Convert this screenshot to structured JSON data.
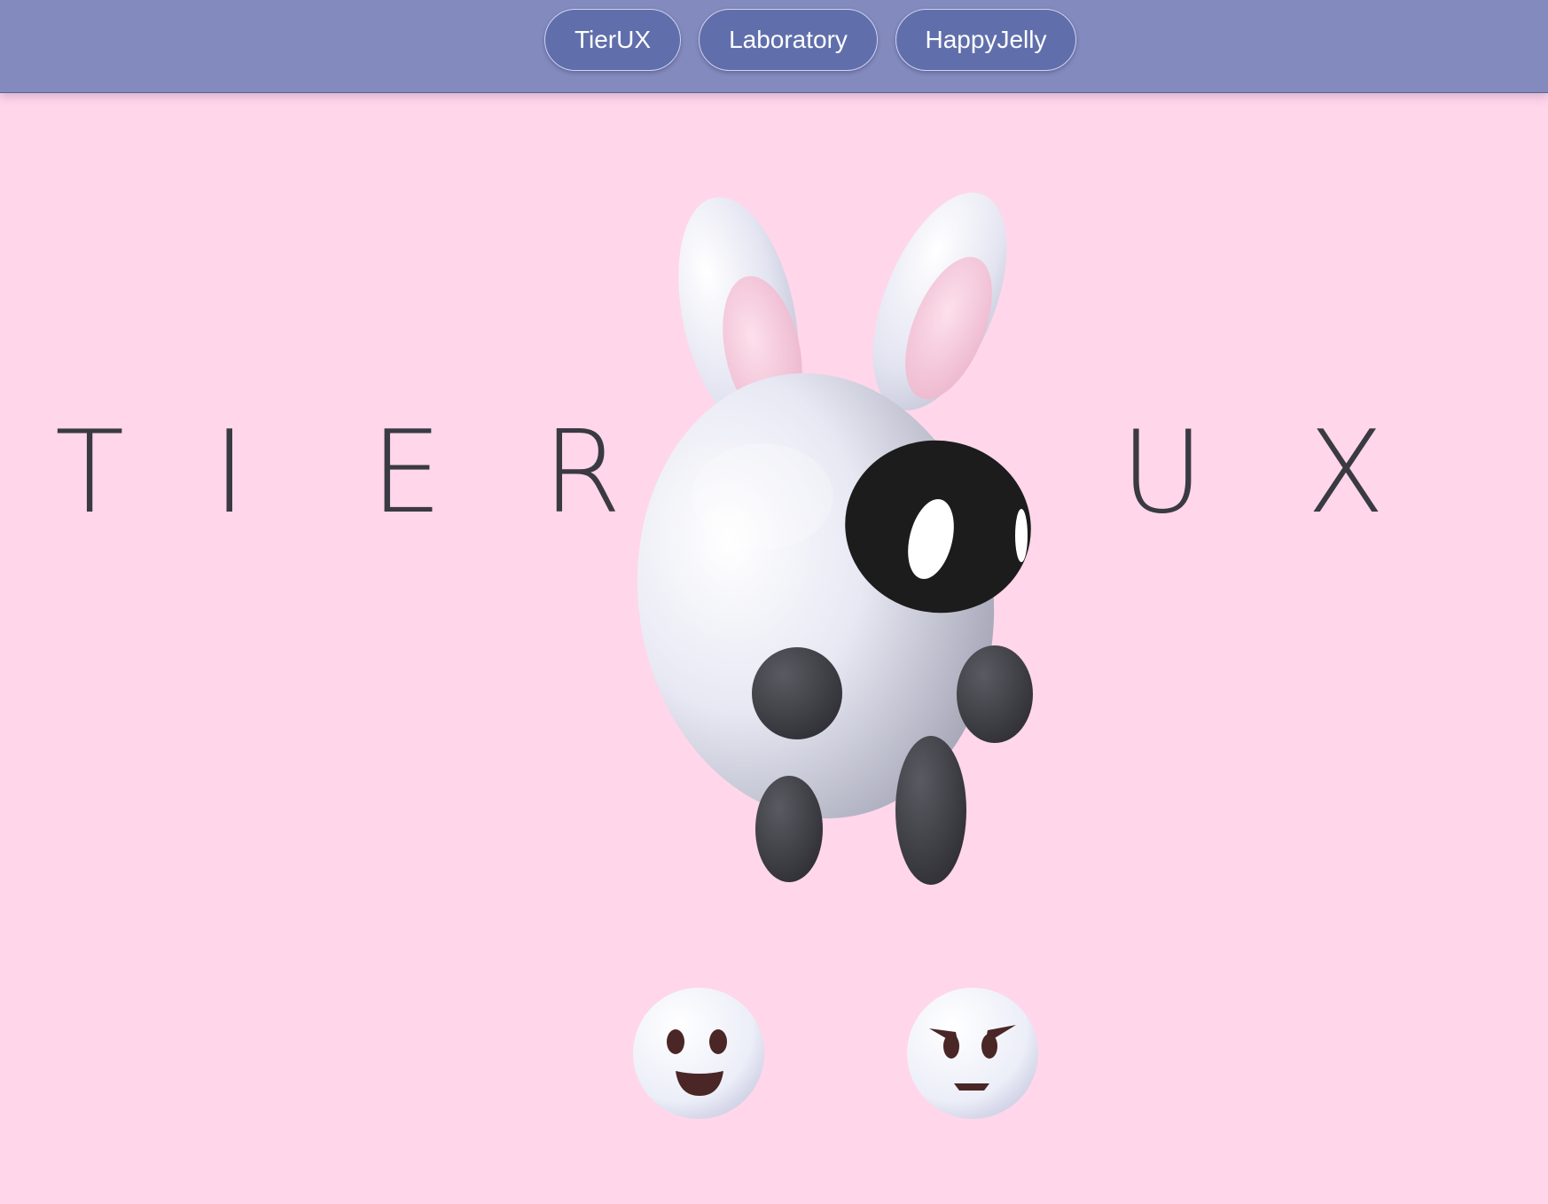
{
  "nav": {
    "items": [
      {
        "label": "TierUX"
      },
      {
        "label": "Laboratory"
      },
      {
        "label": "HappyJelly"
      }
    ]
  },
  "hero": {
    "letters_left": [
      "T",
      "I",
      "E",
      "R"
    ],
    "letters_right": [
      "U",
      "X"
    ]
  },
  "mascot": {
    "icon": "bunny-mascot-icon"
  },
  "moods": [
    {
      "icon": "happy-face-icon"
    },
    {
      "icon": "angry-face-icon"
    }
  ],
  "colors": {
    "background": "#ffd6ea",
    "topbar": "#838abd",
    "button": "#606fab",
    "text": "#3a3a42"
  }
}
